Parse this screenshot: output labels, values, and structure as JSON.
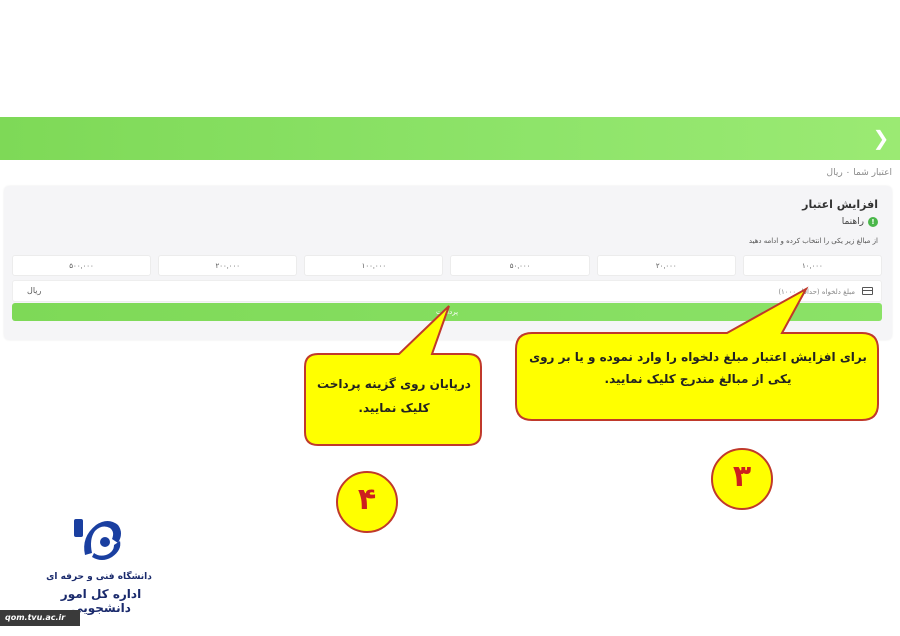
{
  "breadcrumb": "اعتبار شما ۰ ریال",
  "panel": {
    "title": "افزایش اعتبار",
    "guide_label": "راهنما",
    "guide_icon_glyph": "!",
    "instruction": "از مبالغ زیر یکی را انتخاب کرده و ادامه دهید",
    "amounts": [
      "۱۰,۰۰۰",
      "۲۰,۰۰۰",
      "۵۰,۰۰۰",
      "۱۰۰,۰۰۰",
      "۲۰۰,۰۰۰",
      "۵۰۰,۰۰۰"
    ],
    "amount_placeholder": "مبلغ دلخواه (حداقل ۱۰۰۰)",
    "currency_unit": "ریال",
    "pay_button": "پرداخت"
  },
  "callouts": {
    "step3_text_line1": "برای افزایش اعتبار مبلغ دلخواه را وارد نموده و یا بر روی",
    "step3_text_line2": "یکی از مبالغ مندرج کلیک نمایید.",
    "step4_text_line1": "درپایان روی گزینه پرداخت",
    "step4_text_line2": "کلیک نمایید.",
    "step3_number": "۳",
    "step4_number": "۴"
  },
  "logo": {
    "line1": "دانشگاه فنی و حرفه ای",
    "line2": "اداره کل امور دانشجویی"
  },
  "url": "qom.tvu.ac.ir",
  "colors": {
    "accent_green": "#7ed957",
    "callout_yellow": "#ffff00",
    "callout_border": "#c0392b",
    "step_number_red": "#cc1f1f",
    "logo_navy": "#1a2a6c"
  }
}
